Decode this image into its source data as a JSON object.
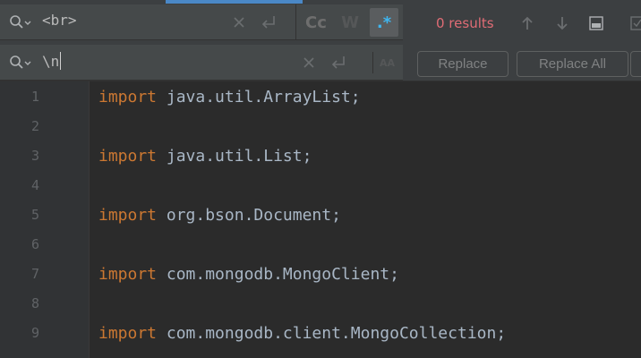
{
  "find": {
    "query": "<br>"
  },
  "replace": {
    "query": "\\n"
  },
  "options": {
    "match_case": "Cc",
    "words": "W",
    "regex": ".*",
    "preserve_case": "AA"
  },
  "status": {
    "results": "0 results"
  },
  "buttons": {
    "replace": "Replace",
    "replace_all": "Replace All"
  },
  "colors": {
    "regex_active": "#3fb6f0",
    "results_text": "#e06c75",
    "tab_indicator": "#4a88c7"
  },
  "editor": {
    "lines": [
      {
        "number": "1",
        "keyword": "import",
        "rest": " java.util.ArrayList;"
      },
      {
        "number": "2",
        "keyword": "",
        "rest": ""
      },
      {
        "number": "3",
        "keyword": "import",
        "rest": " java.util.List;"
      },
      {
        "number": "4",
        "keyword": "",
        "rest": ""
      },
      {
        "number": "5",
        "keyword": "import",
        "rest": " org.bson.Document;"
      },
      {
        "number": "6",
        "keyword": "",
        "rest": ""
      },
      {
        "number": "7",
        "keyword": "import",
        "rest": " com.mongodb.MongoClient;"
      },
      {
        "number": "8",
        "keyword": "",
        "rest": ""
      },
      {
        "number": "9",
        "keyword": "import",
        "rest": " com.mongodb.client.MongoCollection;"
      }
    ]
  }
}
